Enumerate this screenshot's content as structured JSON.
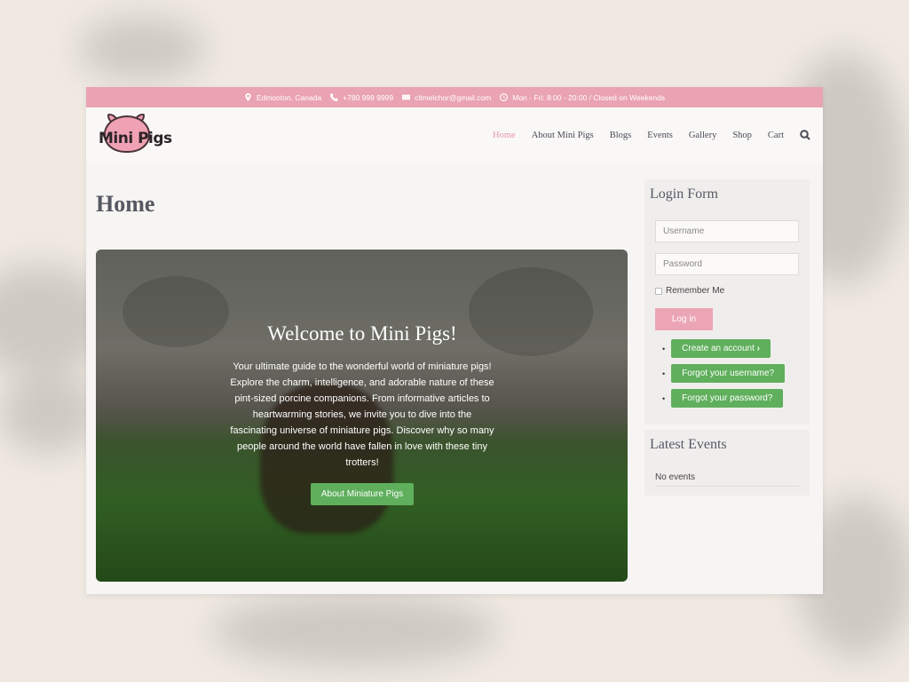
{
  "topbar": {
    "location": "Edmonton, Canada",
    "phone": "+780 999 9999",
    "email": "cltmelchor@gmail.com",
    "hours": "Mon - Fri: 8:00 - 20:00 / Closed on Weekends"
  },
  "logo": {
    "text": "Mini Pigs"
  },
  "nav": {
    "items": [
      "Home",
      "About Mini Pigs",
      "Blogs",
      "Events",
      "Gallery",
      "Shop",
      "Cart"
    ]
  },
  "page": {
    "title": "Home"
  },
  "hero": {
    "heading": "Welcome to Mini Pigs!",
    "body": "Your ultimate guide to the wonderful world of miniature pigs! Explore the charm, intelligence, and adorable nature of these pint-sized porcine companions. From informative articles to heartwarming stories, we invite you to dive into the fascinating universe of miniature pigs. Discover why so many people around the world have fallen in love with these tiny trotters!",
    "button": "About Miniature Pigs"
  },
  "login": {
    "title": "Login Form",
    "username_placeholder": "Username",
    "password_placeholder": "Password",
    "remember": "Remember Me",
    "login_button": "Log in",
    "links": [
      "Create an account",
      "Forgot your username?",
      "Forgot your password?"
    ]
  },
  "events": {
    "title": "Latest Events",
    "empty": "No events"
  },
  "colors": {
    "accent_pink": "#eaa3b2",
    "green": "#5faf5c"
  }
}
